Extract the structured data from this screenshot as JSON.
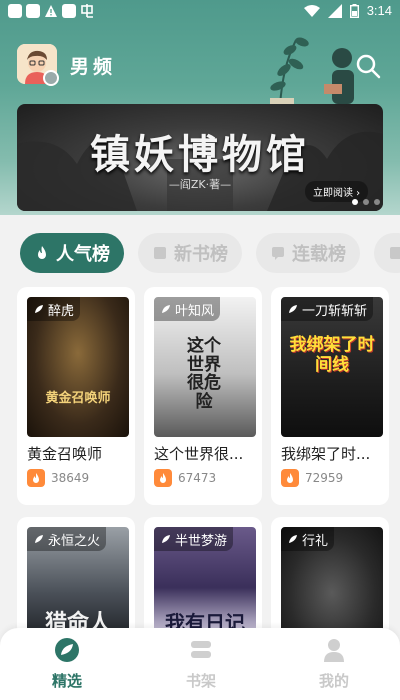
{
  "status_bar": {
    "time": "3:14"
  },
  "header": {
    "channel_label": "男频"
  },
  "banner": {
    "title": "镇妖博物馆",
    "author": "—阎ZK·著—",
    "read_button": "立即阅读",
    "slide_count": 3,
    "active_slide": 1
  },
  "tabs": [
    {
      "label": "人气榜",
      "active": true
    },
    {
      "label": "新书榜",
      "active": false
    },
    {
      "label": "连载榜",
      "active": false
    }
  ],
  "books": [
    {
      "author": "醉虎",
      "title": "黄金召唤师",
      "hot": "38649"
    },
    {
      "author": "叶知风",
      "title": "这个世界很...",
      "hot": "67473"
    },
    {
      "author": "一刀斩斩斩",
      "title": "我绑架了时...",
      "hot": "72959"
    },
    {
      "author": "永恒之火",
      "title": "",
      "hot": ""
    },
    {
      "author": "半世梦游",
      "title": "",
      "hot": ""
    },
    {
      "author": "行礼",
      "title": "",
      "hot": ""
    }
  ],
  "covers": {
    "book1_text": "黄金召唤师",
    "book2_text": "这个世界很危险",
    "book3_text": "我绑架了时间线",
    "book4_text": "猎命人",
    "book5_text": "我有日记"
  },
  "nav": [
    {
      "label": "精选",
      "icon": "leaf-icon",
      "active": true
    },
    {
      "label": "书架",
      "icon": "bookshelf-icon",
      "active": false
    },
    {
      "label": "我的",
      "icon": "person-icon",
      "active": false
    }
  ],
  "colors": {
    "accent": "#2d7567",
    "header": "#5fa797",
    "hot": "#ff8a3a"
  }
}
